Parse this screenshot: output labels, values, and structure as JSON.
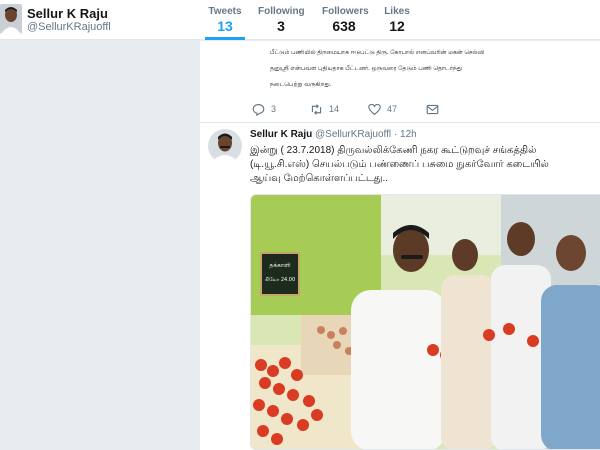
{
  "profile": {
    "name": "Sellur K Raju",
    "handle": "@SellurKRajuoffl"
  },
  "stats": [
    {
      "label": "Tweets",
      "value": "13"
    },
    {
      "label": "Following",
      "value": "3"
    },
    {
      "label": "Followers",
      "value": "638"
    },
    {
      "label": "Likes",
      "value": "12"
    }
  ],
  "prev_tweet": {
    "lines": [
      "பீட்டும் பணியில் திறமையாக ஈடுபட்டு திரு. கோபால் எனப்வரின் மகன் செல்வி",
      "தனுஸ்ரீ என்பவள புதியதாக பீட்டனர். ஒருவரை தேடும் பணி தொடர்ந்து",
      "நடைபெற்று வருகிறது."
    ],
    "replies": "3",
    "retweets": "14",
    "likes": "47"
  },
  "tweet": {
    "name": "Sellur K Raju",
    "handle": "@SellurKRajuoffl",
    "time": "· 12h",
    "lines": [
      "இன்று ( 23.7.2018) திருவல்லிக்கேணி நகர கூட்டுறவுச் சங்கத்தில்",
      "(டி.யூ.சி.எஸ்) செயல்படும் பண்ணைப் பசுமை நுகர்வோர் கடையில்",
      "ஆய்வு மேற்கொள்ளப்பட்டது.."
    ],
    "photo_sign": "தக்காளி",
    "photo_sign_price": "கிலோ 24.00"
  },
  "colors": {
    "accent": "#1da1f2",
    "text": "#14171a",
    "muted": "#657786",
    "background": "#e6ecf0"
  }
}
